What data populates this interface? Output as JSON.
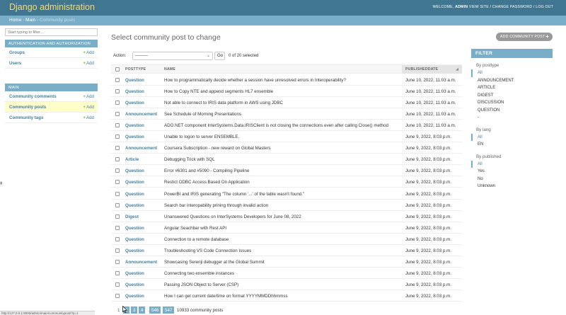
{
  "header": {
    "branding": "Django administration",
    "welcome": "WELCOME,",
    "user": "ADMIN",
    "view_site": "VIEW SITE",
    "change_password": "CHANGE PASSWORD",
    "log_out": "LOG OUT",
    "sep": " / "
  },
  "breadcrumbs": {
    "home": "Home",
    "app": "Main",
    "current": "Community posts",
    "sep": " › "
  },
  "sidebar": {
    "filter_placeholder": "Start typing to filter...",
    "modules": [
      {
        "caption": "AUTHENTICATION AND AUTHORIZATION",
        "rows": [
          {
            "label": "Groups",
            "add": "Add"
          },
          {
            "label": "Users",
            "add": "Add"
          }
        ]
      },
      {
        "caption": "MAIN",
        "rows": [
          {
            "label": "Community comments",
            "add": "Add"
          },
          {
            "label": "Community posts",
            "add": "Add",
            "current": true
          },
          {
            "label": "Community tags",
            "add": "Add"
          }
        ]
      }
    ]
  },
  "main": {
    "title": "Select community post to change",
    "add_button": "ADD COMMUNITY POST",
    "action_label": "Action:",
    "action_value": "---------",
    "go_label": "Go",
    "selected_count": "0 of 20 selected",
    "columns": [
      "POSTTYPE",
      "NAME",
      "PUBLISHEDDATE"
    ],
    "rows": [
      {
        "type": "Question",
        "name": "How to programmatically decide whether a session have unresolved errors in Interoperability?",
        "date": "June 10, 2022, 11:03 a.m."
      },
      {
        "type": "Question",
        "name": "How to Copy NTE and append segments HL7 ensemble",
        "date": "June 10, 2022, 11:03 a.m."
      },
      {
        "type": "Question",
        "name": "Not able to connect to IRIS data platform in AWS using JDBC",
        "date": "June 10, 2022, 11:03 a.m."
      },
      {
        "type": "Announcement",
        "name": "See Schedule of Morning Presentations",
        "date": "June 10, 2022, 11:03 a.m."
      },
      {
        "type": "Question",
        "name": "ADO.NET component InterSystems.Data.IRISClient is not closing the connections even after calling Close() method",
        "date": "June 10, 2022, 11:03 a.m."
      },
      {
        "type": "Question",
        "name": "Unable to logon to server ENSEMBLE.",
        "date": "June 9, 2022, 8:03 p.m."
      },
      {
        "type": "Announcement",
        "name": "Coursera Subscription - new reward on Global Masters",
        "date": "June 9, 2022, 8:03 p.m."
      },
      {
        "type": "Article",
        "name": "Debugging Trick with SQL",
        "date": "June 9, 2022, 8:03 p.m."
      },
      {
        "type": "Question",
        "name": "Error #6301 and #5090 - Compiling Pipeline",
        "date": "June 9, 2022, 8:03 p.m."
      },
      {
        "type": "Question",
        "name": "Restict ODBC Access Based On Application",
        "date": "June 9, 2022, 8:03 p.m."
      },
      {
        "type": "Question",
        "name": "PowerBI and IRIS generating \"The column '...' of the table wasn't found.\"",
        "date": "June 9, 2022, 8:03 p.m."
      },
      {
        "type": "Question",
        "name": "Search bar interopability prining through invalid action",
        "date": "June 9, 2022, 8:03 p.m."
      },
      {
        "type": "Digest",
        "name": "Unanswered Questions on InterSystems Developers for June 08, 2022",
        "date": "June 9, 2022, 8:03 p.m."
      },
      {
        "type": "Question",
        "name": "Angular Seachbar with Rest API",
        "date": "June 9, 2022, 8:03 p.m."
      },
      {
        "type": "Question",
        "name": "Connection to a remote database",
        "date": "June 9, 2022, 8:03 p.m."
      },
      {
        "type": "Question",
        "name": "Troubleshooting VS Code Connection Issues",
        "date": "June 9, 2022, 8:03 p.m."
      },
      {
        "type": "Announcement",
        "name": "Showcasing Serenji debugger at the Global Summit",
        "date": "June 9, 2022, 8:03 p.m."
      },
      {
        "type": "Question",
        "name": "Connecting two ensemble instances",
        "date": "June 9, 2022, 8:03 p.m."
      },
      {
        "type": "Question",
        "name": "Passing JSON Object to Server (CSP)",
        "date": "June 9, 2022, 8:03 p.m."
      },
      {
        "type": "Question",
        "name": "How I can get current date/time on format YYYYMMDDhhmmss",
        "date": "June 9, 2022, 8:03 p.m."
      }
    ],
    "pagination": {
      "pages": [
        "1",
        "2",
        "3",
        "4",
        "...",
        "546",
        "547"
      ],
      "result_count": "10933 community posts"
    }
  },
  "filter": {
    "title": "FILTER",
    "groups": [
      {
        "title": "By posttype",
        "options": [
          "All",
          "ANNOUNCEMENT",
          "ARTICLE",
          "DIGEST",
          "DISCUSSION",
          "QUESTION",
          "-"
        ]
      },
      {
        "title": "By lang",
        "options": [
          "All",
          "EN"
        ]
      },
      {
        "title": "By published",
        "options": [
          "All",
          "Yes",
          "No",
          "Unknown"
        ]
      }
    ]
  },
  "misc": {
    "edge_glyph": "ǂ",
    "status_url": "http://127.0.0.1:8000/admin/main/communitypost/?p=1"
  },
  "colors": {
    "header_bg": "#417690",
    "branding": "#f5dd5d",
    "module_caption": "#79aec8",
    "link": "#447e9b",
    "add_plus": "#70bf2b",
    "current_row": "#ffffcc"
  }
}
